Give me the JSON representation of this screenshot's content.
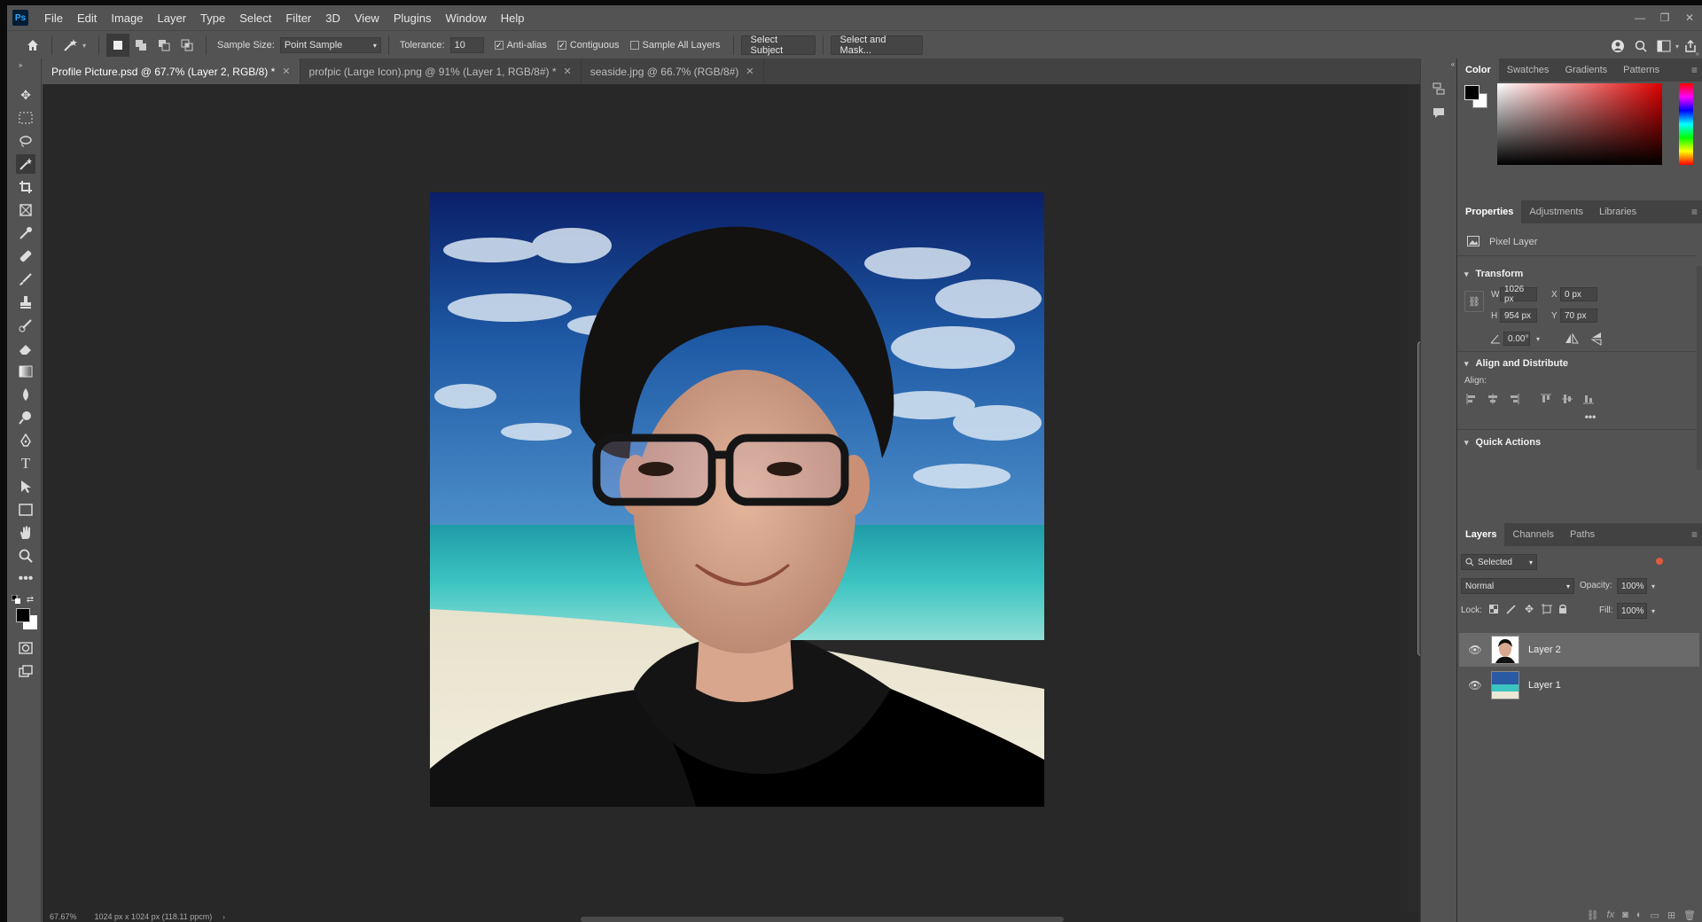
{
  "app": {
    "logo": "Ps"
  },
  "menu": [
    "File",
    "Edit",
    "Image",
    "Layer",
    "Type",
    "Select",
    "Filter",
    "3D",
    "View",
    "Plugins",
    "Window",
    "Help"
  ],
  "options": {
    "sample_size_label": "Sample Size:",
    "sample_size_value": "Point Sample",
    "tolerance_label": "Tolerance:",
    "tolerance_value": "10",
    "anti_alias": "Anti-alias",
    "contiguous": "Contiguous",
    "sample_all_layers": "Sample All Layers",
    "select_subject": "Select Subject",
    "select_and_mask": "Select and Mask..."
  },
  "tabs": [
    {
      "label": "Profile Picture.psd @ 67.7% (Layer 2, RGB/8) *",
      "active": true
    },
    {
      "label": "profpic (Large Icon).png @ 91% (Layer 1, RGB/8#) *",
      "active": false
    },
    {
      "label": "seaside.jpg @ 66.7% (RGB/8#)",
      "active": false
    }
  ],
  "status": {
    "zoom": "67.67%",
    "doc_info": "1024 px x 1024 px (118.11 ppcm)"
  },
  "color_panel": {
    "tabs": [
      "Color",
      "Swatches",
      "Gradients",
      "Patterns"
    ],
    "foreground": "#000000",
    "background": "#ffffff",
    "hue_color": "#e00000"
  },
  "properties_panel": {
    "tabs": [
      "Properties",
      "Adjustments",
      "Libraries"
    ],
    "layer_type": "Pixel Layer",
    "transform_title": "Transform",
    "w_label": "W",
    "w_value": "1026 px",
    "h_label": "H",
    "h_value": "954 px",
    "x_label": "X",
    "x_value": "0 px",
    "y_label": "Y",
    "y_value": "70 px",
    "angle_value": "0.00°",
    "align_title": "Align and Distribute",
    "align_label": "Align:",
    "quick_actions_title": "Quick Actions"
  },
  "layers_panel": {
    "tabs": [
      "Layers",
      "Channels",
      "Paths"
    ],
    "filter_value": "Selected",
    "blend_mode": "Normal",
    "opacity_label": "Opacity:",
    "opacity_value": "100%",
    "lock_label": "Lock:",
    "fill_label": "Fill:",
    "fill_value": "100%",
    "layers": [
      {
        "name": "Layer 2",
        "selected": true
      },
      {
        "name": "Layer 1",
        "selected": false
      }
    ]
  }
}
